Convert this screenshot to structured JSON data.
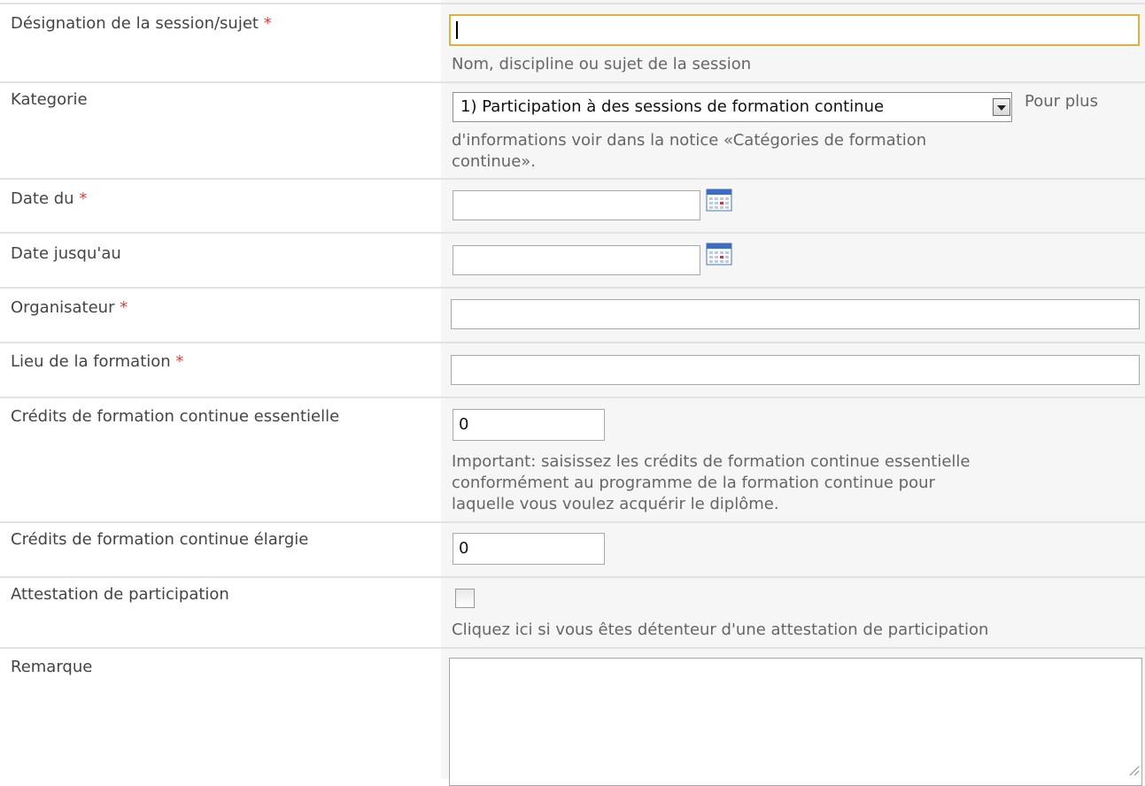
{
  "required_marker": "*",
  "fields": {
    "designation": {
      "label": "Désignation de la session/sujet",
      "value": "",
      "hint": "Nom, discipline ou sujet de la session"
    },
    "kategorie": {
      "label": "Kategorie",
      "selected": "1) Participation à des sessions de formation continue",
      "inline_hint": "Pour plus",
      "hint_line2": "d'informations voir dans la notice «Catégories de formation",
      "hint_line3": "continue»."
    },
    "date_du": {
      "label": "Date du",
      "value": ""
    },
    "date_jusquau": {
      "label": "Date jusqu'au",
      "value": ""
    },
    "organisateur": {
      "label": "Organisateur",
      "value": ""
    },
    "lieu": {
      "label": "Lieu de la formation",
      "value": ""
    },
    "credits_essentielle": {
      "label": "Crédits de formation continue essentielle",
      "value": "0",
      "hint_line1": "Important:  saisissez les crédits de formation continue essentielle",
      "hint_line2": "conformément au programme de la formation continue pour",
      "hint_line3": "laquelle vous voulez acquérir le diplôme."
    },
    "credits_elargie": {
      "label": "Crédits de formation continue élargie",
      "value": "0"
    },
    "attestation": {
      "label": "Attestation de participation",
      "checked": false,
      "hint": "Cliquez ici si vous êtes détenteur d'une attestation de participation"
    },
    "remarque": {
      "label": "Remarque",
      "value": ""
    }
  },
  "colors": {
    "required": "#e23c3c",
    "focus_border": "#e0b03c",
    "field_background": "#f6f6f6"
  }
}
